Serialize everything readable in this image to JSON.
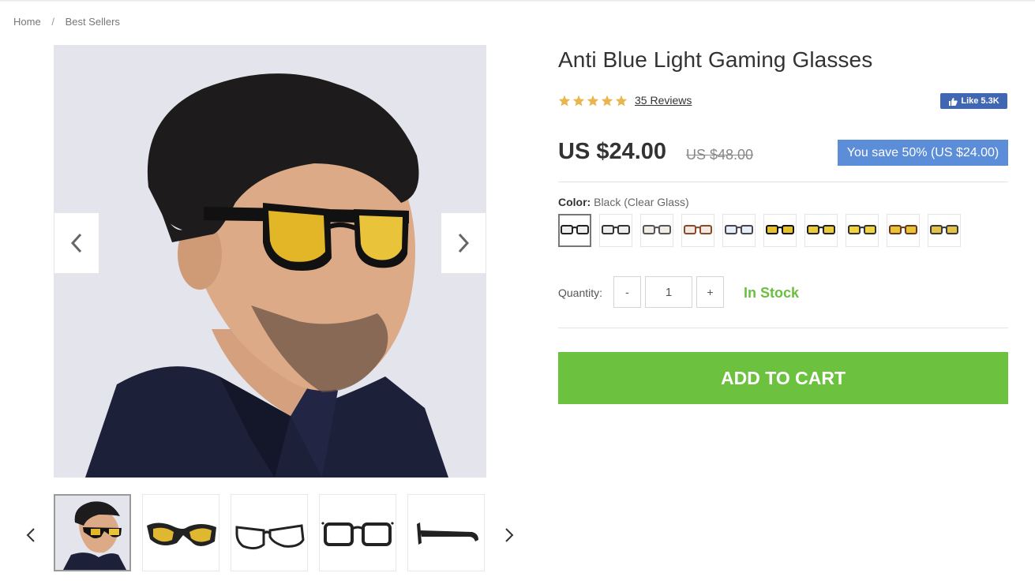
{
  "breadcrumb": {
    "home": "Home",
    "separator": "/",
    "current": "Best Sellers"
  },
  "product": {
    "title": "Anti Blue Light Gaming Glasses",
    "rating": 5,
    "reviews_label": "35 Reviews",
    "fb_like_label": "Like 5.3K",
    "price": "US $24.00",
    "old_price": "US $48.00",
    "save_label": "You save 50% (US $24.00)",
    "color_label": "Color:",
    "color_value": "Black (Clear Glass)",
    "swatch_count": 10,
    "quantity_label": "Quantity:",
    "quantity_value": "1",
    "qty_minus": "-",
    "qty_plus": "+",
    "stock_label": "In Stock",
    "add_to_cart": "ADD TO CART"
  },
  "colors": {
    "accent_green": "#6cc13f",
    "stock_green": "#6abf40",
    "save_blue": "#5b8dd9",
    "facebook_blue": "#4267b2",
    "star": "#e8b54e"
  },
  "icons": {
    "image_prev": "chevron-left-icon",
    "image_next": "chevron-right-icon",
    "star": "star-icon",
    "thumb_prev": "chevron-left-icon",
    "thumb_next": "chevron-right-icon"
  }
}
